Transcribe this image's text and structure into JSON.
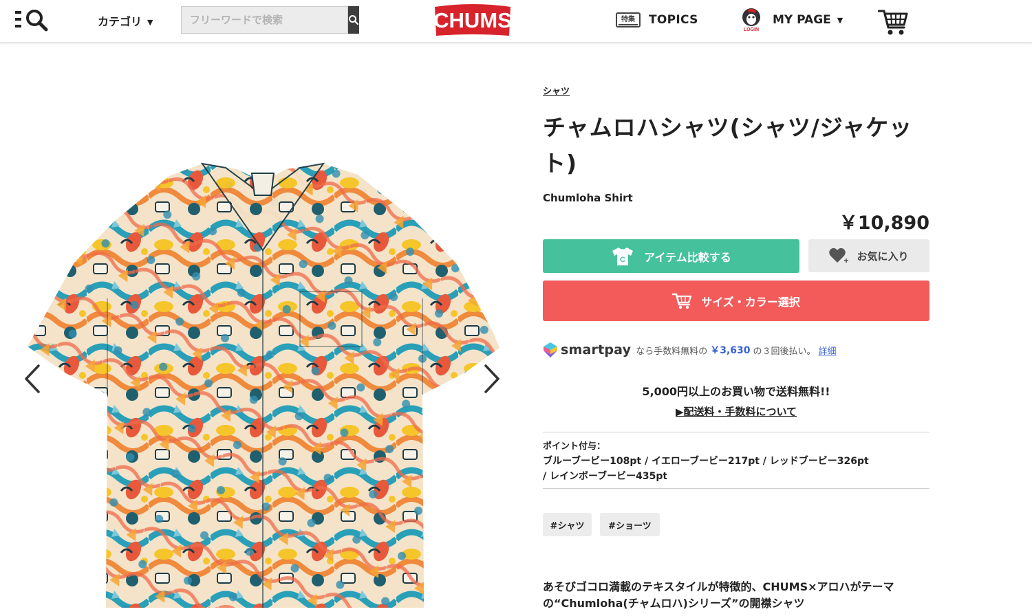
{
  "header": {
    "menu_icon": "menu-search-icon",
    "category_label": "カテゴリ",
    "category_caret": "▼",
    "search_placeholder": "フリーワードで検索",
    "search_icon": "search-icon",
    "logo_text": "CHUMS",
    "topics_badge": "特集",
    "topics_label": "TOPICS",
    "login_badge": "LOGIN",
    "mypage_label": "MY PAGE",
    "mypage_caret": "▼",
    "cart_icon": "cart-icon"
  },
  "gallery": {
    "prev_icon": "chevron-left-icon",
    "next_icon": "chevron-right-icon"
  },
  "product": {
    "category": "シャツ",
    "title": "チャムロハシャツ(シャツ/ジャケット)",
    "subtitle": "Chumloha Shirt",
    "price": "￥10,890",
    "compare_label": "アイテム比較する",
    "compare_icon_letter": "C",
    "favorite_label": "お気に入り",
    "size_color_label": "サイズ・カラー選択"
  },
  "smartpay": {
    "brand": "smartpay",
    "text_before": "なら手数料無料の",
    "amount": "￥3,630",
    "text_after": "の３回後払い。",
    "link": "詳細"
  },
  "shipping": {
    "free_text": "5,000円以上のお買い物で送料無料!!",
    "link_text": "▶配送料・手数料について"
  },
  "points": {
    "label": "ポイント付与：",
    "line1": "ブルーブービー108pt / イエローブービー217pt / レッドブービー326pt",
    "line2": " / レインボーブービー435pt"
  },
  "tags": [
    "#シャツ",
    "#ショーツ"
  ],
  "description": {
    "line1": "あそびゴコロ満載のテキスタイルが特徴的、CHUMS×アロハがテーマ",
    "line2": "の“Chumloha(チャムロハ)シリーズ”の開襟シャツ"
  },
  "colors": {
    "compare_green": "#45c19c",
    "size_red": "#f35b5b",
    "logo_red": "#d7242c",
    "smartpay_blue": "#3a63d6"
  }
}
